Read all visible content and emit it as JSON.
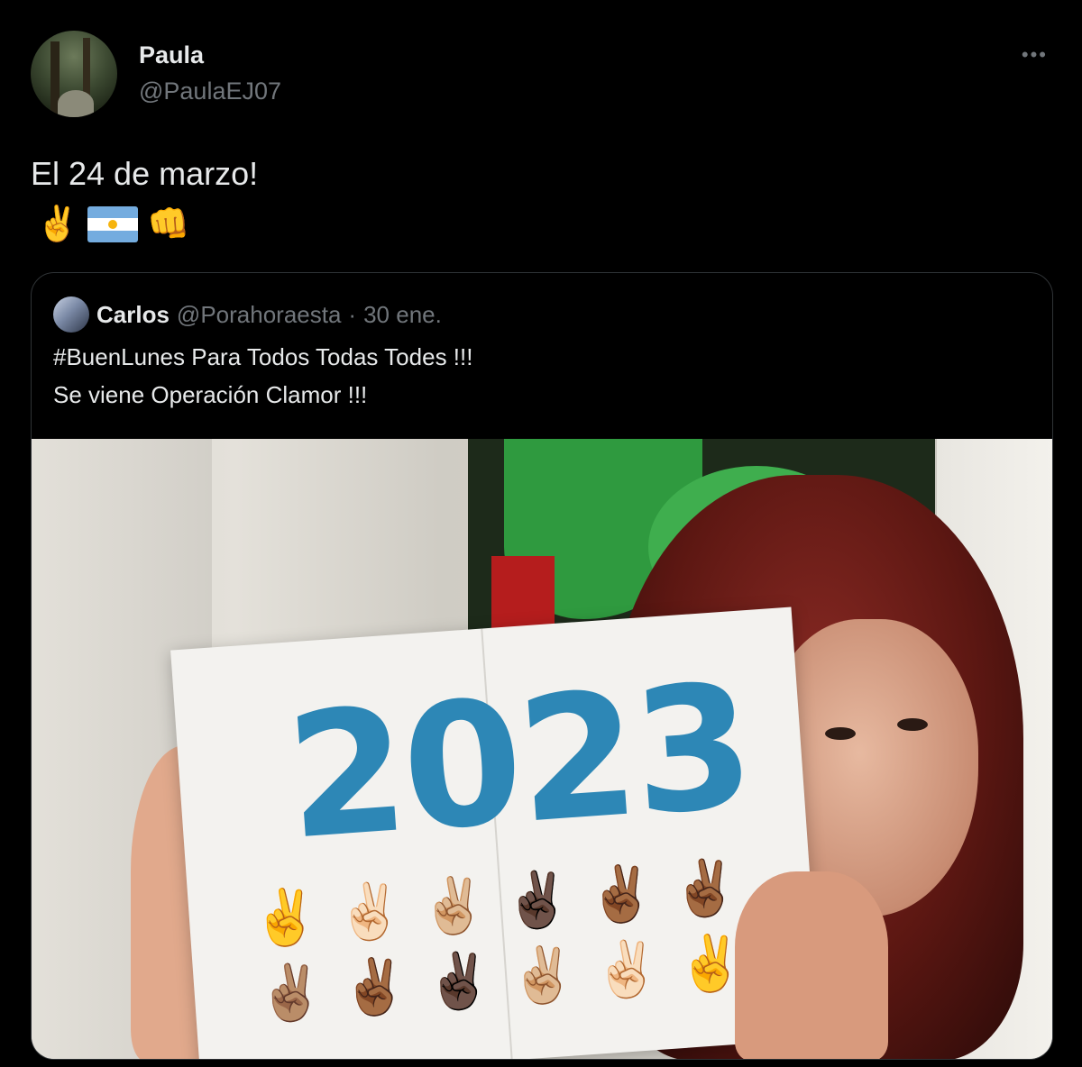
{
  "tweet": {
    "author_name": "Paula",
    "author_handle": "@PaulaEJ07",
    "more_label": "•••",
    "text": "El 24 de marzo!",
    "emojis": [
      "✌️",
      "🇦🇷",
      "👊"
    ]
  },
  "quote": {
    "author_name": "Carlos",
    "author_handle": "@Porahoraesta",
    "separator": "·",
    "time": "30 ene.",
    "line1": "#BuenLunes Para Todos Todas Todes !!!",
    "line2": "Se viene Operación Clamor !!!",
    "photo": {
      "sign_text": "2023",
      "hand_emojis": [
        "✌️",
        "✌🏻",
        "✌🏼",
        "✌🏿",
        "✌🏾",
        "✌🏾",
        "✌🏽",
        "✌🏾",
        "✌🏿",
        "✌🏼",
        "✌🏻",
        "✌️"
      ]
    }
  },
  "colors": {
    "background": "#000000",
    "text_primary": "#e7e9ea",
    "text_secondary": "#71767b",
    "border": "#2f3336",
    "sign_blue": "#2d87b6"
  }
}
